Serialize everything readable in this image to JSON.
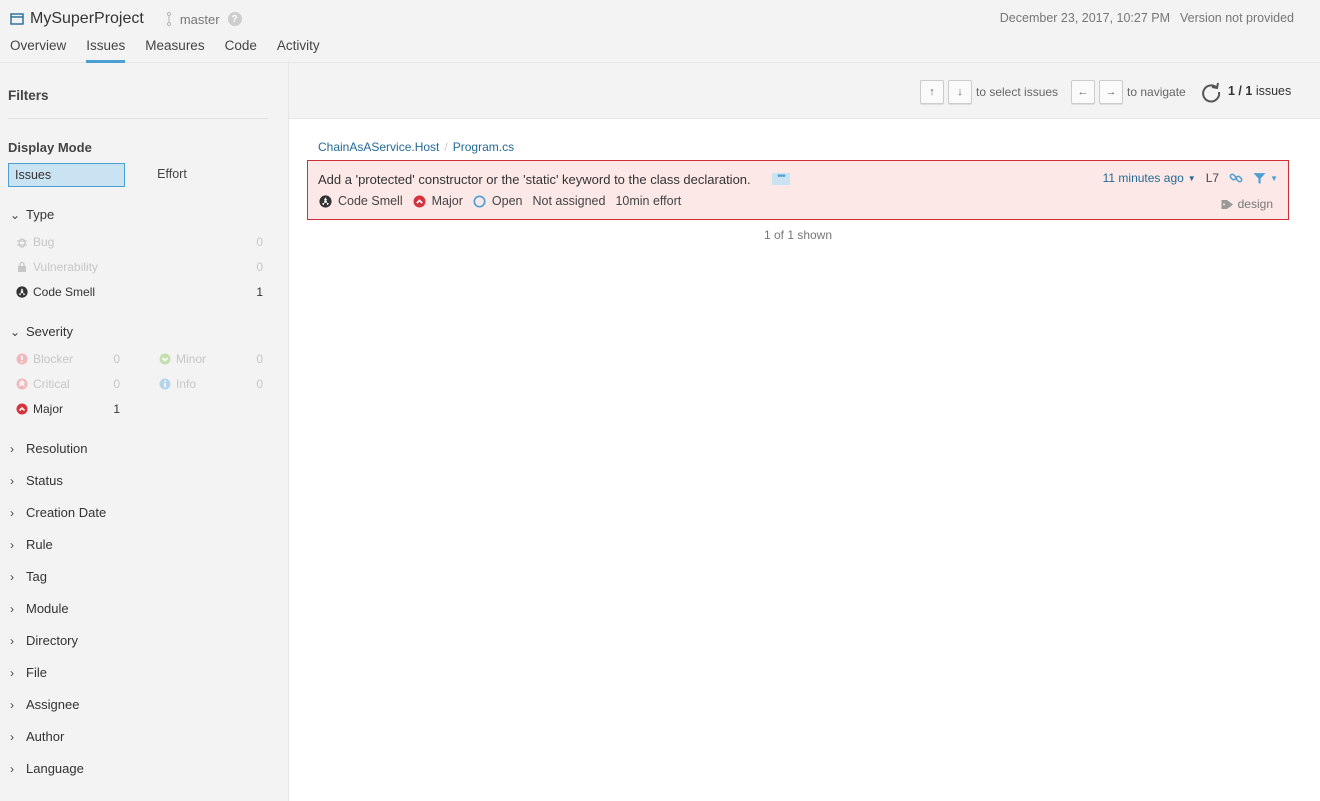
{
  "header": {
    "project_name": "MySuperProject",
    "branch": "master",
    "date": "December 23, 2017, 10:27 PM",
    "version": "Version not provided",
    "tabs": [
      {
        "label": "Overview"
      },
      {
        "label": "Issues",
        "active": true
      },
      {
        "label": "Measures"
      },
      {
        "label": "Code"
      },
      {
        "label": "Activity"
      }
    ]
  },
  "sidebar": {
    "title": "Filters",
    "display_mode": {
      "label": "Display Mode",
      "issues": "Issues",
      "effort": "Effort",
      "selected": "Issues"
    },
    "type": {
      "label": "Type",
      "items": [
        {
          "label": "Bug",
          "count": "0",
          "icon": "bug-icon"
        },
        {
          "label": "Vulnerability",
          "count": "0",
          "icon": "lock-icon"
        },
        {
          "label": "Code Smell",
          "count": "1",
          "icon": "code-smell-icon"
        }
      ]
    },
    "severity": {
      "label": "Severity",
      "items": [
        {
          "label": "Blocker",
          "count": "0",
          "icon": "blocker-icon"
        },
        {
          "label": "Minor",
          "count": "0",
          "icon": "minor-icon"
        },
        {
          "label": "Critical",
          "count": "0",
          "icon": "critical-icon"
        },
        {
          "label": "Info",
          "count": "0",
          "icon": "info-icon"
        },
        {
          "label": "Major",
          "count": "1",
          "icon": "major-icon"
        }
      ]
    },
    "facets": [
      "Resolution",
      "Status",
      "Creation Date",
      "Rule",
      "Tag",
      "Module",
      "Directory",
      "File",
      "Assignee",
      "Author",
      "Language"
    ]
  },
  "toolbar": {
    "up_key": "↑",
    "down_key": "↓",
    "select_text": "to select issues",
    "left_key": "←",
    "right_key": "→",
    "navigate_text": "to navigate",
    "count_current": "1 / 1",
    "count_suffix": "issues"
  },
  "breadcrumb": {
    "project": "ChainAsAService.Host",
    "file": "Program.cs"
  },
  "issue": {
    "message": "Add a 'protected' constructor or the 'static' keyword to the class declaration.",
    "type": "Code Smell",
    "severity": "Major",
    "status": "Open",
    "assignee": "Not assigned",
    "effort": "10min effort",
    "age": "11 minutes ago",
    "line": "L7",
    "tag": "design"
  },
  "footer": {
    "shown": "1 of 1 shown"
  },
  "colors": {
    "accent": "#4b9fd5",
    "issue_bg": "#fde8e8",
    "issue_border": "#d02f3a",
    "major": "#d4333f"
  }
}
